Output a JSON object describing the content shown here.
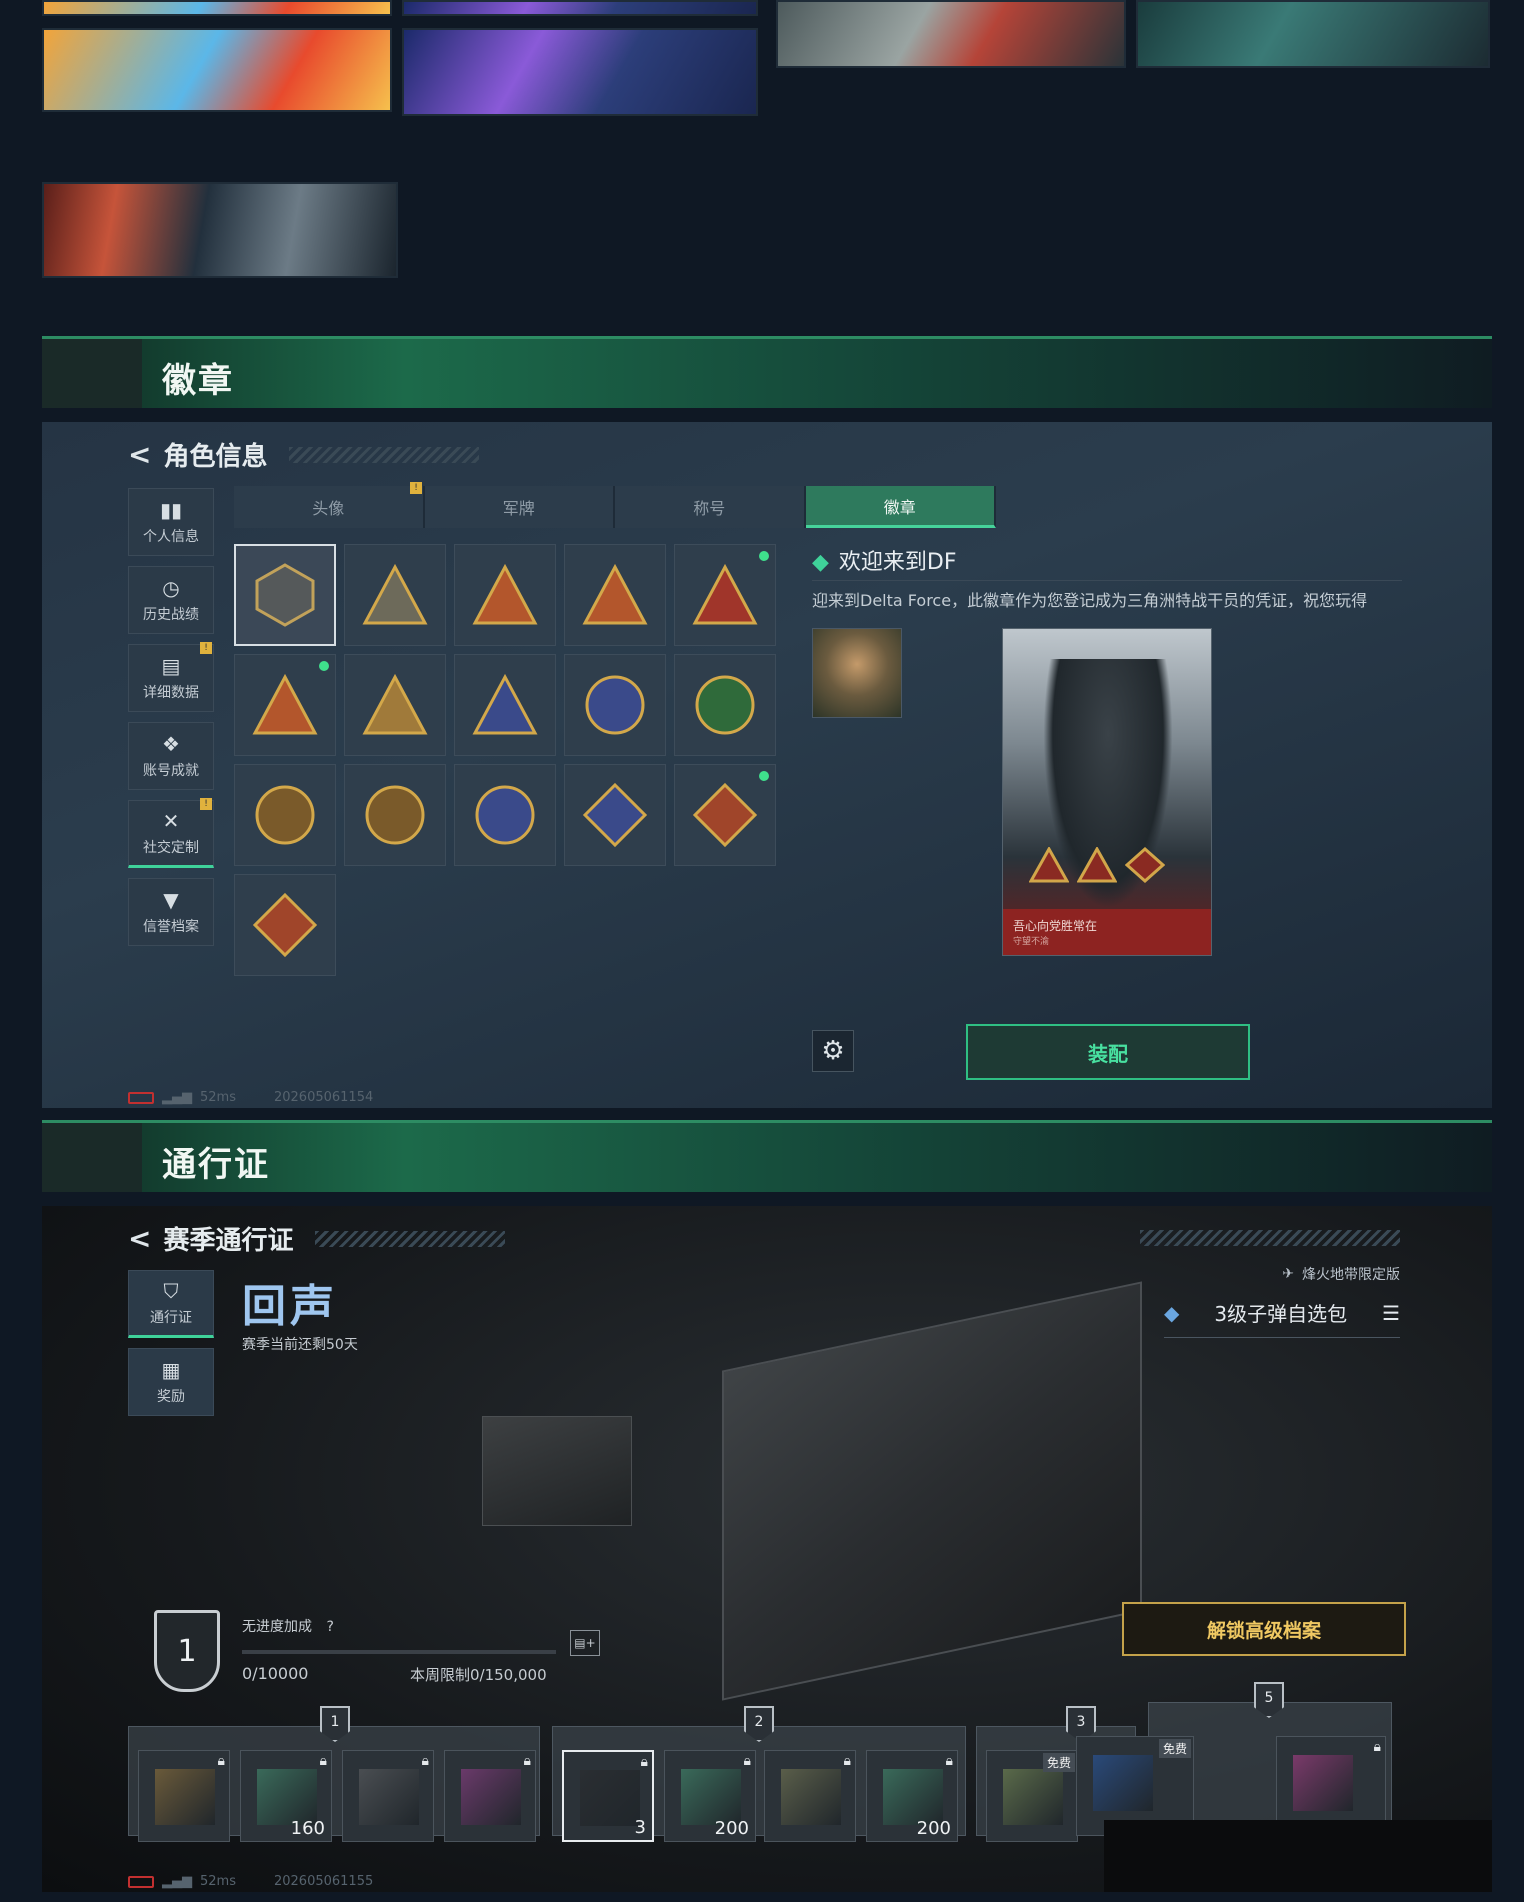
{
  "gallery": {
    "thumbnails": [
      "art-a",
      "art-b",
      "art-c",
      "art-d",
      "art-e"
    ]
  },
  "badges_section": {
    "header": "徽章"
  },
  "role_panel": {
    "back_label": "角色信息",
    "sidebar": [
      {
        "label": "个人信息",
        "icon": "bar-chart-icon"
      },
      {
        "label": "历史战绩",
        "icon": "clock-icon"
      },
      {
        "label": "详细数据",
        "icon": "folder-icon"
      },
      {
        "label": "账号成就",
        "icon": "medal-icon"
      },
      {
        "label": "社交定制",
        "icon": "tools-icon"
      },
      {
        "label": "信誉档案",
        "icon": "shield-down-icon"
      }
    ],
    "tabs": [
      "头像",
      "军牌",
      "称号",
      "徽章"
    ],
    "active_tab": "徽章",
    "badge_grid_count": 16,
    "detail_title": "欢迎来到DF",
    "detail_desc": "迎来到Delta Force，此徽章作为您登记成为三角洲特战干员的凭证，祝您玩得",
    "card_caption": "吾心向党胜常在",
    "card_sub": "守望不渝",
    "equip_label": "装配",
    "status_ping": "52ms",
    "status_id": "202605061154"
  },
  "pass_section": {
    "header": "通行证"
  },
  "pass_panel": {
    "back_label": "赛季通行证",
    "sidebar": [
      {
        "label": "通行证",
        "icon": "pass-icon"
      },
      {
        "label": "奖励",
        "icon": "gift-icon"
      }
    ],
    "season_logo": "回声",
    "season_remaining": "赛季当前还剩50天",
    "limited_label": "烽火地带限定版",
    "reward_title": "3级子弹自选包",
    "rank": "1",
    "bonus_label": "无进度加成",
    "bonus_help": "?",
    "xp_progress": 0.0,
    "xp_value": "0/10000",
    "weekly_limit": "本周限制0/150,000",
    "unlock_label": "解锁高级档案",
    "milestones": [
      "1",
      "2",
      "3",
      "5"
    ],
    "items": [
      {
        "qty": "",
        "locked": true,
        "free": ""
      },
      {
        "qty": "160",
        "locked": true,
        "free": ""
      },
      {
        "qty": "",
        "locked": true,
        "free": ""
      },
      {
        "qty": "",
        "locked": true,
        "free": ""
      },
      {
        "qty": "3",
        "locked": true,
        "free": ""
      },
      {
        "qty": "200",
        "locked": true,
        "free": ""
      },
      {
        "qty": "",
        "locked": true,
        "free": ""
      },
      {
        "qty": "200",
        "locked": true,
        "free": ""
      },
      {
        "qty": "",
        "locked": false,
        "free": "免费"
      },
      {
        "qty": "",
        "locked": false,
        "free": "免费"
      },
      {
        "qty": "",
        "locked": true,
        "free": ""
      }
    ],
    "status_ping": "52ms",
    "status_id": "202605061155"
  }
}
